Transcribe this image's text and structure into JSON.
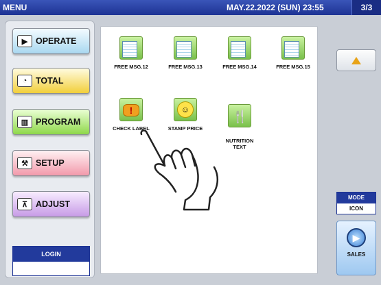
{
  "header": {
    "title": "MENU",
    "datetime": "MAY.22.2022 (SUN)  23:55",
    "page": "3/3"
  },
  "menu": {
    "operate": "OPERATE",
    "total": "TOTAL",
    "program": "PROGRAM",
    "setup": "SETUP",
    "adjust": "ADJUST",
    "login": "LOGIN"
  },
  "tiles": [
    {
      "label": "FREE MSG.12",
      "icon": "document-icon"
    },
    {
      "label": "FREE MSG.13",
      "icon": "document-icon"
    },
    {
      "label": "FREE MSG.14",
      "icon": "document-icon"
    },
    {
      "label": "FREE MSG.15",
      "icon": "document-icon"
    },
    {
      "label": "CHECK LABEL",
      "icon": "speech-bubble-icon"
    },
    {
      "label": "STAMP PRICE",
      "icon": "smiley-icon"
    },
    {
      "label": "NUTRITION\nTEXT",
      "icon": "cutlery-icon"
    }
  ],
  "mode": {
    "label": "MODE",
    "value": "ICON"
  },
  "sales": {
    "label": "SALES"
  },
  "colors": {
    "header": "#1d3394",
    "accent": "#e8a317"
  }
}
